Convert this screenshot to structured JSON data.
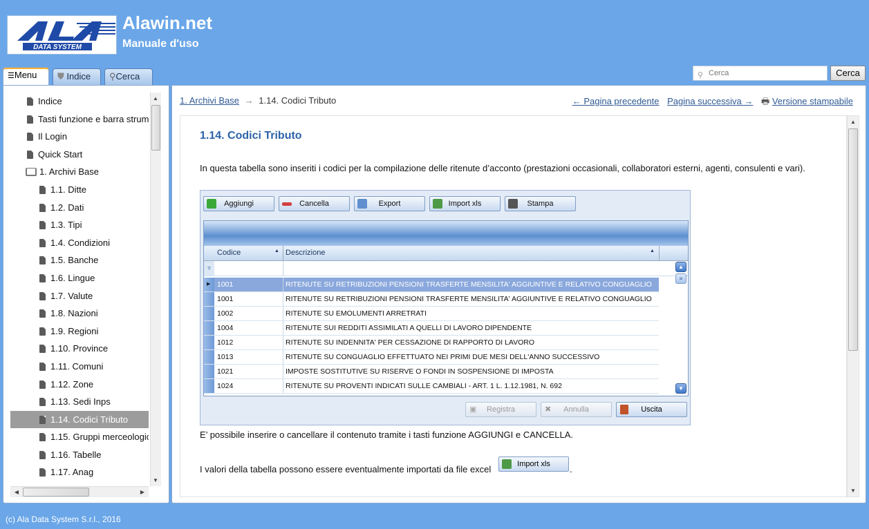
{
  "header": {
    "app_title": "Alawin.net",
    "app_subtitle": "Manuale d'uso",
    "logo_text": "ALA",
    "logo_sub": "DATA SYSTEM"
  },
  "search": {
    "placeholder": "Cerca",
    "button": "Cerca"
  },
  "tabs": [
    {
      "label": "Menu",
      "icon": "list-icon"
    },
    {
      "label": "Indice",
      "icon": "pin-icon"
    },
    {
      "label": "Cerca",
      "icon": "magnifier-icon"
    }
  ],
  "sidebar": {
    "items": [
      {
        "label": "Indice",
        "level": 0,
        "icon": "document-icon"
      },
      {
        "label": "Tasti funzione e barra strum",
        "level": 0,
        "icon": "document-icon"
      },
      {
        "label": "Il Login",
        "level": 0,
        "icon": "document-icon"
      },
      {
        "label": "Quick Start",
        "level": 0,
        "icon": "document-icon"
      },
      {
        "label": "1. Archivi Base",
        "level": 0,
        "icon": "book-icon"
      },
      {
        "label": "1.1. Ditte",
        "level": 1,
        "icon": "document-icon"
      },
      {
        "label": "1.2. Dati",
        "level": 1,
        "icon": "document-icon"
      },
      {
        "label": "1.3. Tipi",
        "level": 1,
        "icon": "document-icon"
      },
      {
        "label": "1.4. Condizioni",
        "level": 1,
        "icon": "document-icon"
      },
      {
        "label": "1.5. Banche",
        "level": 1,
        "icon": "document-icon"
      },
      {
        "label": "1.6. Lingue",
        "level": 1,
        "icon": "document-icon"
      },
      {
        "label": "1.7. Valute",
        "level": 1,
        "icon": "document-icon"
      },
      {
        "label": "1.8. Nazioni",
        "level": 1,
        "icon": "document-icon"
      },
      {
        "label": "1.9. Regioni",
        "level": 1,
        "icon": "document-icon"
      },
      {
        "label": "1.10. Province",
        "level": 1,
        "icon": "document-icon"
      },
      {
        "label": "1.11. Comuni",
        "level": 1,
        "icon": "document-icon"
      },
      {
        "label": "1.12. Zone",
        "level": 1,
        "icon": "document-icon"
      },
      {
        "label": "1.13. Sedi Inps",
        "level": 1,
        "icon": "document-icon"
      },
      {
        "label": "1.14. Codici Tributo",
        "level": 1,
        "icon": "document-icon",
        "selected": true
      },
      {
        "label": "1.15. Gruppi merceologic",
        "level": 1,
        "icon": "document-icon"
      },
      {
        "label": "1.16. Tabelle",
        "level": 1,
        "icon": "document-icon"
      },
      {
        "label": "1.17. Anag",
        "level": 1,
        "icon": "document-icon"
      }
    ]
  },
  "breadcrumb": {
    "parent": "1. Archivi Base",
    "arrow": "→",
    "current": "1.14. Codici Tributo"
  },
  "pagenav": {
    "prev": "← Pagina precedente",
    "next": "Pagina successiva →",
    "print": "Versione stampabile"
  },
  "article": {
    "title": "1.14. Codici Tributo",
    "intro": "In questa tabella sono inseriti i codici per la compilazione delle ritenute d’acconto (prestazioni occasionali, collaboratori esterni, agenti, consulenti e vari).",
    "text2": "E’ possibile inserire o cancellare il contenuto tramite i tasti funzione AGGIUNGI e CANCELLA.",
    "text3": "I valori della tabella possono essere eventualmente importati da file excel",
    "text3_button": "Import xls",
    "text3_end": "."
  },
  "screenshot": {
    "toolbar": [
      "Aggiungi",
      "Cancella",
      "Export",
      "Import xls",
      "Stampa"
    ],
    "columns": [
      "Codice",
      "Descrizione"
    ],
    "rows": [
      {
        "codice": "1001",
        "descrizione": "RITENUTE SU RETRIBUZIONI PENSIONI TRASFERTE MENSILITA' AGGIUNTIVE E RELATIVO CONGUAGLIO",
        "selected": true
      },
      {
        "codice": "1001",
        "descrizione": "RITENUTE SU RETRIBUZIONI PENSIONI TRASFERTE MENSILITA' AGGIUNTIVE E RELATIVO CONGUAGLIO"
      },
      {
        "codice": "1002",
        "descrizione": "RITENUTE SU EMOLUMENTI ARRETRATI"
      },
      {
        "codice": "1004",
        "descrizione": "RITENUTE SUI REDDITI ASSIMILATI A QUELLI DI LAVORO DIPENDENTE"
      },
      {
        "codice": "1012",
        "descrizione": "RITENUTE SU INDENNITA' PER CESSAZIONE DI RAPPORTO DI LAVORO"
      },
      {
        "codice": "1013",
        "descrizione": "RITENUTE SU CONGUAGLIO EFFETTUATO NEI PRIMI DUE MESI DELL'ANNO SUCCESSIVO"
      },
      {
        "codice": "1021",
        "descrizione": "IMPOSTE SOSTITUTIVE SU RISERVE O FONDI IN SOSPENSIONE DI IMPOSTA"
      },
      {
        "codice": "1024",
        "descrizione": "RITENUTE SU PROVENTI INDICATI SULLE CAMBIALI - ART. 1 L. 1.12.1981, N. 692"
      }
    ],
    "bottom_buttons": [
      "Registra",
      "Annulla",
      "Uscita"
    ]
  },
  "footer": "(c) Ala Data System S.r.l., 2016",
  "colors": {
    "background": "#6aa6e8",
    "link": "#2f5a94",
    "title": "#2d62a8",
    "selected_item": "#9c9c9c"
  }
}
